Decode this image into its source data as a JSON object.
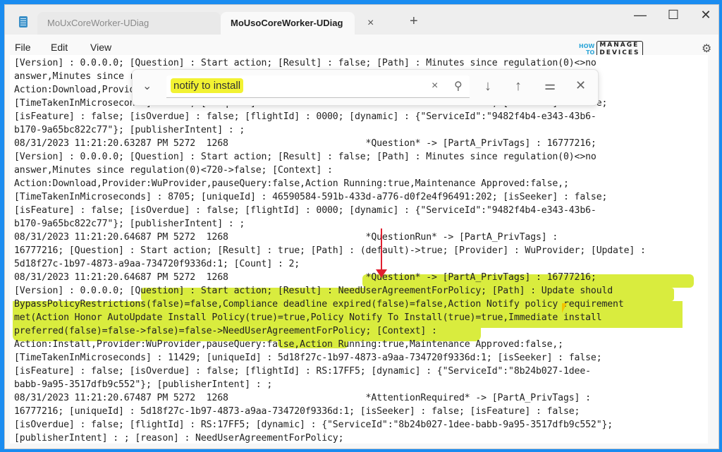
{
  "window": {
    "tabs": [
      {
        "label": "MoUxCoreWorker-UDiag",
        "active": false
      },
      {
        "label": "MoUsoCoreWorker-UDiag",
        "active": true
      }
    ],
    "tab_close_icon": "×",
    "tab_add_icon": "+",
    "minimize_icon": "—",
    "maximize_icon": "☐",
    "close_icon": "✕"
  },
  "menu": {
    "items": [
      "File",
      "Edit",
      "View"
    ],
    "settings_icon": "⚙"
  },
  "logo": {
    "how": "HOW",
    "to": "TO",
    "manage": "MANAGE",
    "devices": "DEVICES"
  },
  "find": {
    "query": "notify to install",
    "chevron_icon": "⌄",
    "clear_icon": "×",
    "search_icon": "⚲",
    "next_icon": "↓",
    "prev_icon": "↑",
    "options_icon": "⚌",
    "close_icon": "✕"
  },
  "colors": {
    "highlight": "#d6ea2e",
    "arrow": "#e02030",
    "window_border": "#1a8cf0"
  },
  "log_lines": [
    "[Version] : 0.0.0.0; [Question] : Start action; [Result] : false; [Path] : Minutes since regulation(0)<>no",
    "answer,Minutes since regulation(0)<720->false; [Context] :",
    "Action:Download,Provider:WuProvider,pauseQuery:false,Action Running:true,Maintenance Approved:false,;",
    "[TimeTakenInMicroseconds] : 2832; [uniqueId] : 5e406f0e-59fa-432d-bb9a-77d2db6f74ec:200; [isSeeker] : false;",
    "[isFeature] : false; [isOverdue] : false; [flightId] : 0000; [dynamic] : {\"ServiceId\":\"9482f4b4-e343-43b6-",
    "b170-9a65bc822c77\"}; [publisherIntent] : ;",
    "08/31/2023 11:21:20.63287 PM 5272  1268                         *Question* -> [PartA_PrivTags] : 16777216;",
    "[Version] : 0.0.0.0; [Question] : Start action; [Result] : false; [Path] : Minutes since regulation(0)<>no",
    "answer,Minutes since regulation(0)<720->false; [Context] :",
    "Action:Download,Provider:WuProvider,pauseQuery:false,Action Running:true,Maintenance Approved:false,;",
    "[TimeTakenInMicroseconds] : 8705; [uniqueId] : 46590584-591b-433d-a776-d0f2e4f96491:202; [isSeeker] : false;",
    "[isFeature] : false; [isOverdue] : false; [flightId] : 0000; [dynamic] : {\"ServiceId\":\"9482f4b4-e343-43b6-",
    "b170-9a65bc822c77\"}; [publisherIntent] : ;",
    "08/31/2023 11:21:20.64687 PM 5272  1268                         *QuestionRun* -> [PartA_PrivTags] :",
    "16777216; [Question] : Start action; [Result] : true; [Path] : (default)->true; [Provider] : WuProvider; [Update] :",
    "5d18f27c-1b97-4873-a9aa-734720f9336d:1; [Count] : 2;",
    "08/31/2023 11:21:20.64687 PM 5272  1268                         *Question* -> [PartA_PrivTags] : 16777216;",
    "[Version] : 0.0.0.0; [Question] : Start action; [Result] : NeedUserAgreementForPolicy; [Path] : Update should",
    "BypassPolicyRestrictions(false)=false,Compliance deadline expired(false)=false,Action Notify policy requirement",
    "met(Action Honor AutoUpdate Install Policy(true)=true,Policy Notify To Install(true)=true,Immediate install",
    "preferred(false)=false->false)=false->NeedUserAgreementForPolicy; [Context] :",
    "Action:Install,Provider:WuProvider,pauseQuery:false,Action Running:true,Maintenance Approved:false,;",
    "[TimeTakenInMicroseconds] : 11429; [uniqueId] : 5d18f27c-1b97-4873-a9aa-734720f9336d:1; [isSeeker] : false;",
    "[isFeature] : false; [isOverdue] : false; [flightId] : RS:17FF5; [dynamic] : {\"ServiceId\":\"8b24b027-1dee-",
    "babb-9a95-3517dfb9c552\"}; [publisherIntent] : ;",
    "08/31/2023 11:21:20.67487 PM 5272  1268                         *AttentionRequired* -> [PartA_PrivTags] :",
    "16777216; [uniqueId] : 5d18f27c-1b97-4873-a9aa-734720f9336d:1; [isSeeker] : false; [isFeature] : false;",
    "[isOverdue] : false; [flightId] : RS:17FF5; [dynamic] : {\"ServiceId\":\"8b24b027-1dee-babb-9a95-3517dfb9c552\"};",
    "[publisherIntent] : ; [reason] : NeedUserAgreementForPolicy;"
  ]
}
